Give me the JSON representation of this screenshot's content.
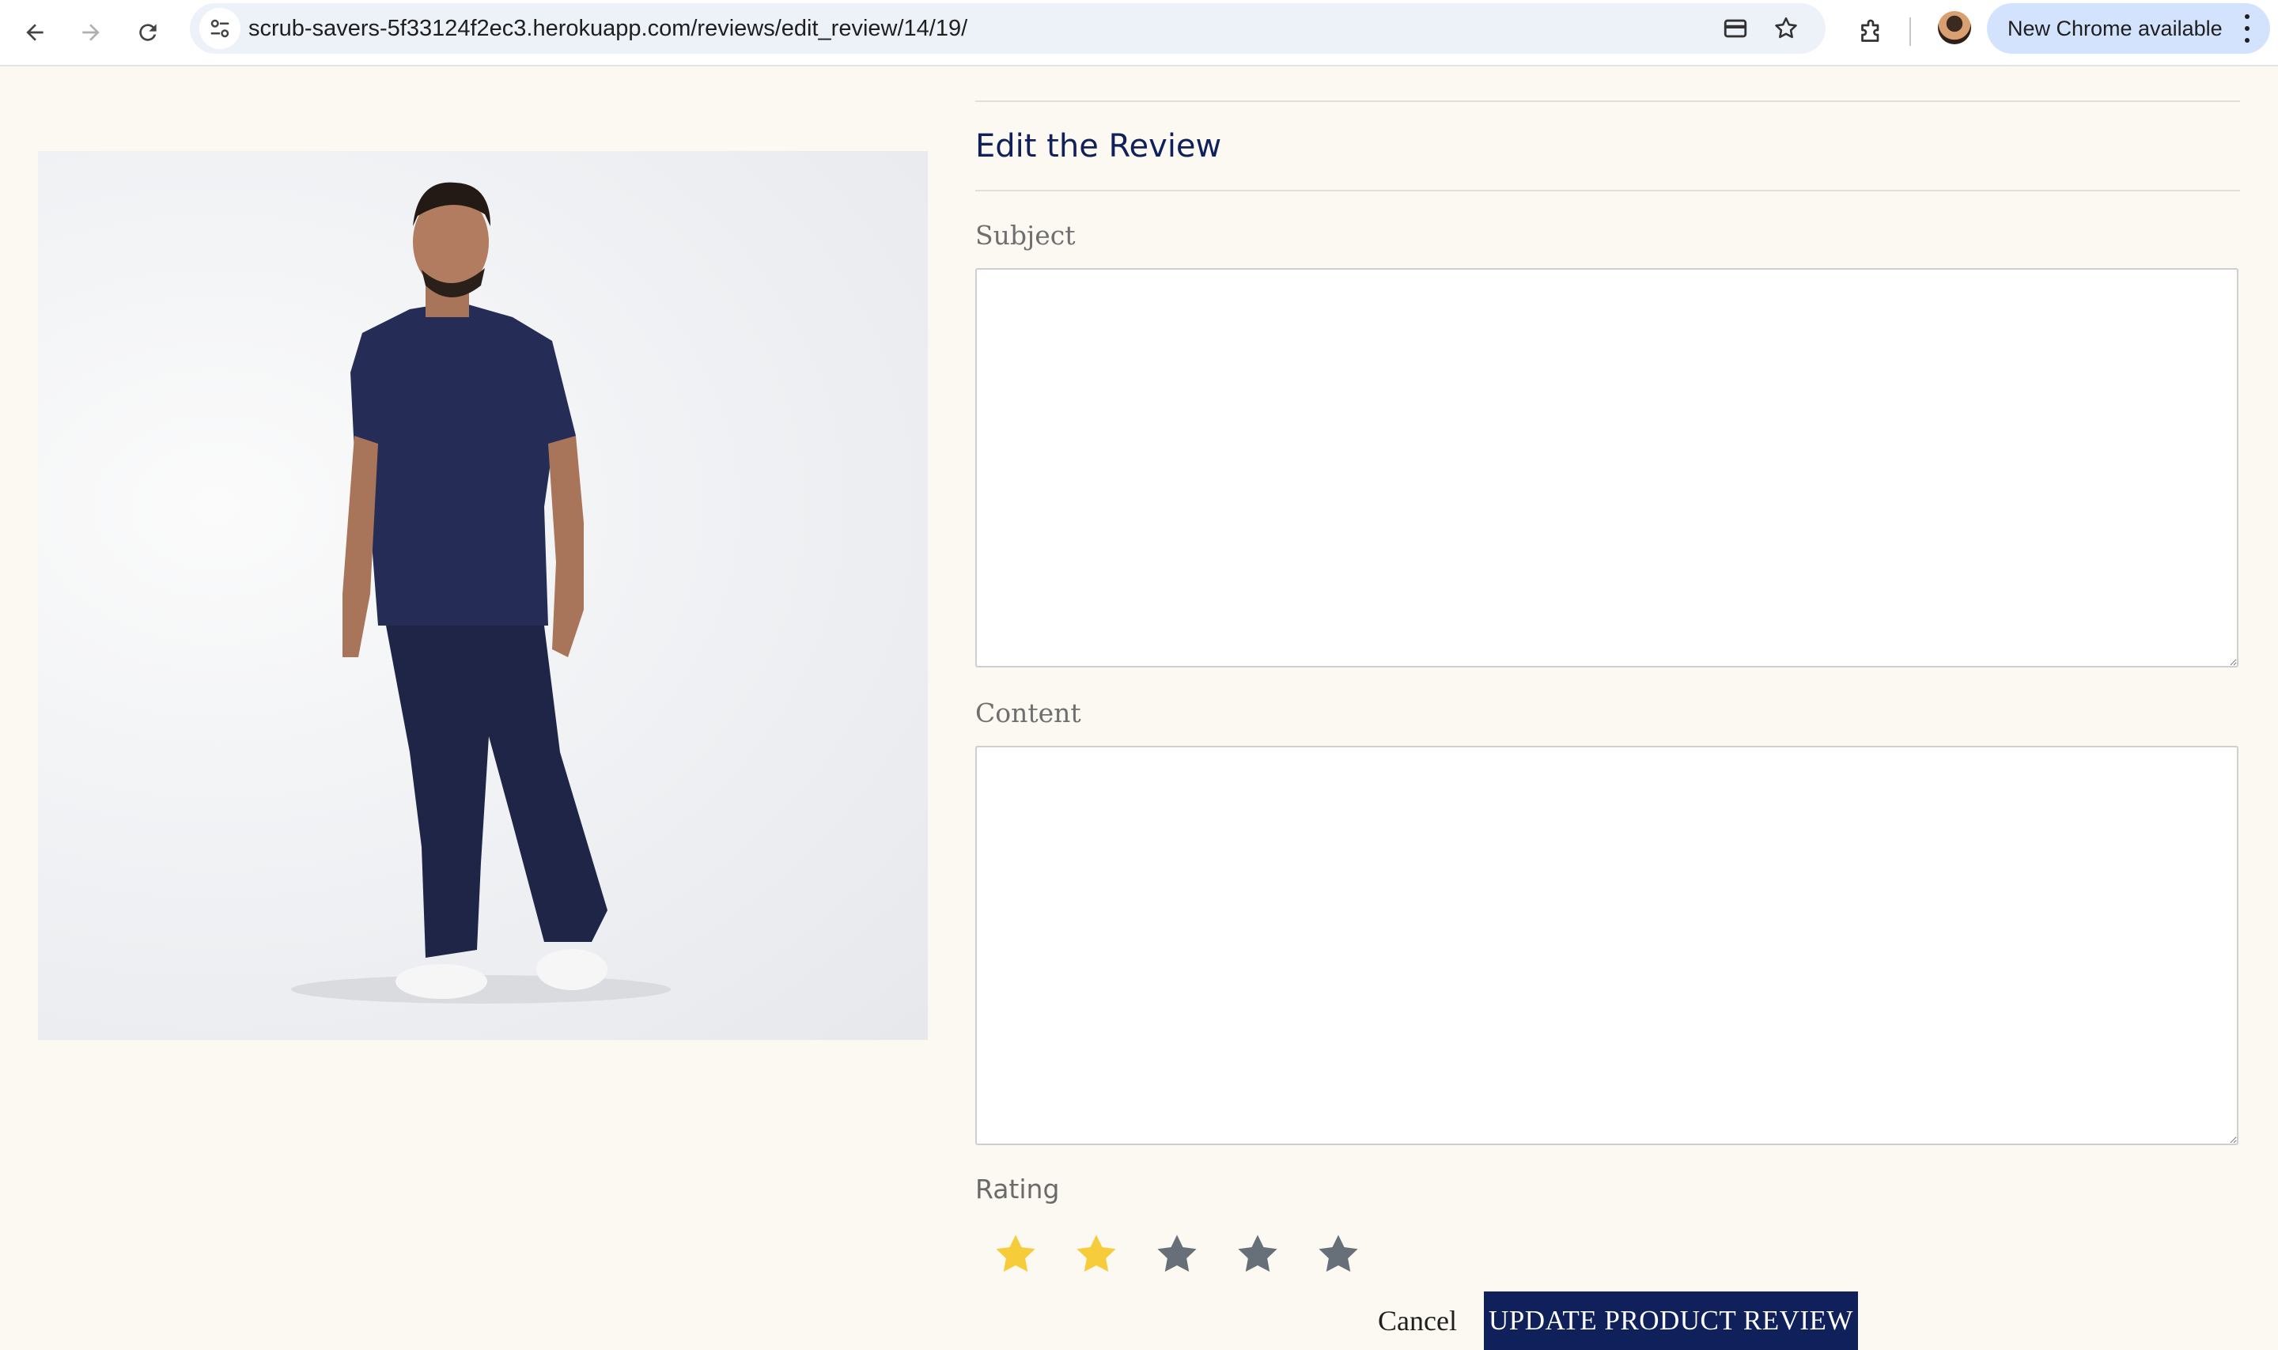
{
  "browser": {
    "url": "scrub-savers-5f33124f2ec3.herokuapp.com/reviews/edit_review/14/19/",
    "update_notice": "New Chrome available",
    "icons": [
      "back-arrow-icon",
      "forward-arrow-icon",
      "reload-icon",
      "site-info-icon",
      "card-icon",
      "bookmark-star-icon",
      "extensions-icon",
      "profile-avatar",
      "more-vert-icon"
    ]
  },
  "product": {
    "image_alt": "Man wearing navy scrub top and trousers with white clogs"
  },
  "form": {
    "title": "Edit the Review",
    "subject_label": "Subject",
    "subject_value": "",
    "content_label": "Content",
    "content_value": "",
    "rating_label": "Rating",
    "rating_value": 2,
    "rating_max": 5,
    "cancel_label": "Cancel",
    "submit_label": "UPDATE PRODUCT REVIEW"
  },
  "colors": {
    "page_background": "#fcf8f2",
    "brand_navy": "#10205a",
    "star_active": "#f6cc3a",
    "star_inactive": "#676f78"
  }
}
